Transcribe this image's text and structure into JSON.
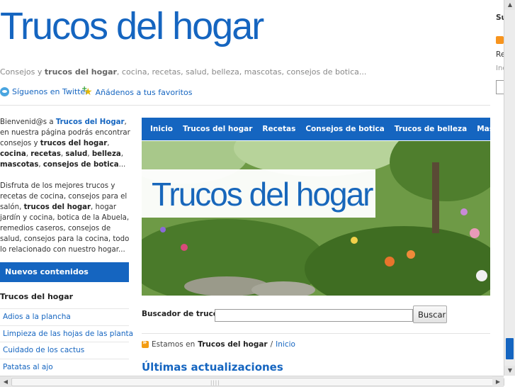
{
  "header": {
    "site_title": "Trucos del hogar",
    "tagline_prefix": "Consejos y ",
    "tagline_bold": "trucos del hogar",
    "tagline_rest": ", cocina, recetas, salud, belleza, mascotas, consejos de botica...",
    "twitter_link": "Síguenos en Twitter",
    "favorites_link": "Añádenos a tus favoritos"
  },
  "intro": {
    "p1_a": "Bienvenid@s a ",
    "p1_link": "Trucos del Hogar",
    "p1_b": ", en nuestra página podrás encontrar consejos y ",
    "p1_c": "trucos del hogar",
    "p1_d": ", ",
    "p1_e": "cocina",
    "p1_f": ", ",
    "p1_g": "recetas",
    "p1_h": ", ",
    "p1_i": "salud",
    "p1_j": ", ",
    "p1_k": "belleza",
    "p1_l": ", ",
    "p1_m": "mascotas",
    "p1_n": ", ",
    "p1_o": "consejos de botica",
    "p1_p": "...",
    "p2_a": "Disfruta de los mejores trucos y recetas de cocina, consejos para el salón, ",
    "p2_b": "trucos del hogar",
    "p2_c": ", hogar jardín y cocina, botica de la Abuela, remedios caseros, consejos de salud, consejos para la cocina, todo lo relacionado con nuestro hogar..."
  },
  "sidebar": {
    "new_content": "Nuevos contenidos",
    "heading": "Trucos del hogar",
    "items": [
      {
        "label": "Adios a la plancha"
      },
      {
        "label": "Limpieza de las hojas de las planta"
      },
      {
        "label": "Cuidado de los cactus"
      },
      {
        "label": "Patatas al ajo"
      }
    ]
  },
  "nav": {
    "items": [
      {
        "label": "Inicio"
      },
      {
        "label": "Trucos del hogar"
      },
      {
        "label": "Recetas"
      },
      {
        "label": "Consejos de botica"
      },
      {
        "label": "Trucos de belleza"
      },
      {
        "label": "Mascotas"
      }
    ]
  },
  "banner": {
    "title": "Trucos del hogar"
  },
  "search": {
    "label": "Buscador de trucos",
    "value": "",
    "button": "Buscar"
  },
  "breadcrumb": {
    "prefix": "Estamos en ",
    "current": "Trucos del hogar",
    "separator": " / ",
    "link": "Inicio"
  },
  "main": {
    "section_title": "Últimas actualizaciones"
  },
  "right": {
    "heading": "Su",
    "re": "Re",
    "in": "Inc"
  },
  "colors": {
    "brand_blue": "#1565c0",
    "rss_orange": "#f7941e"
  }
}
